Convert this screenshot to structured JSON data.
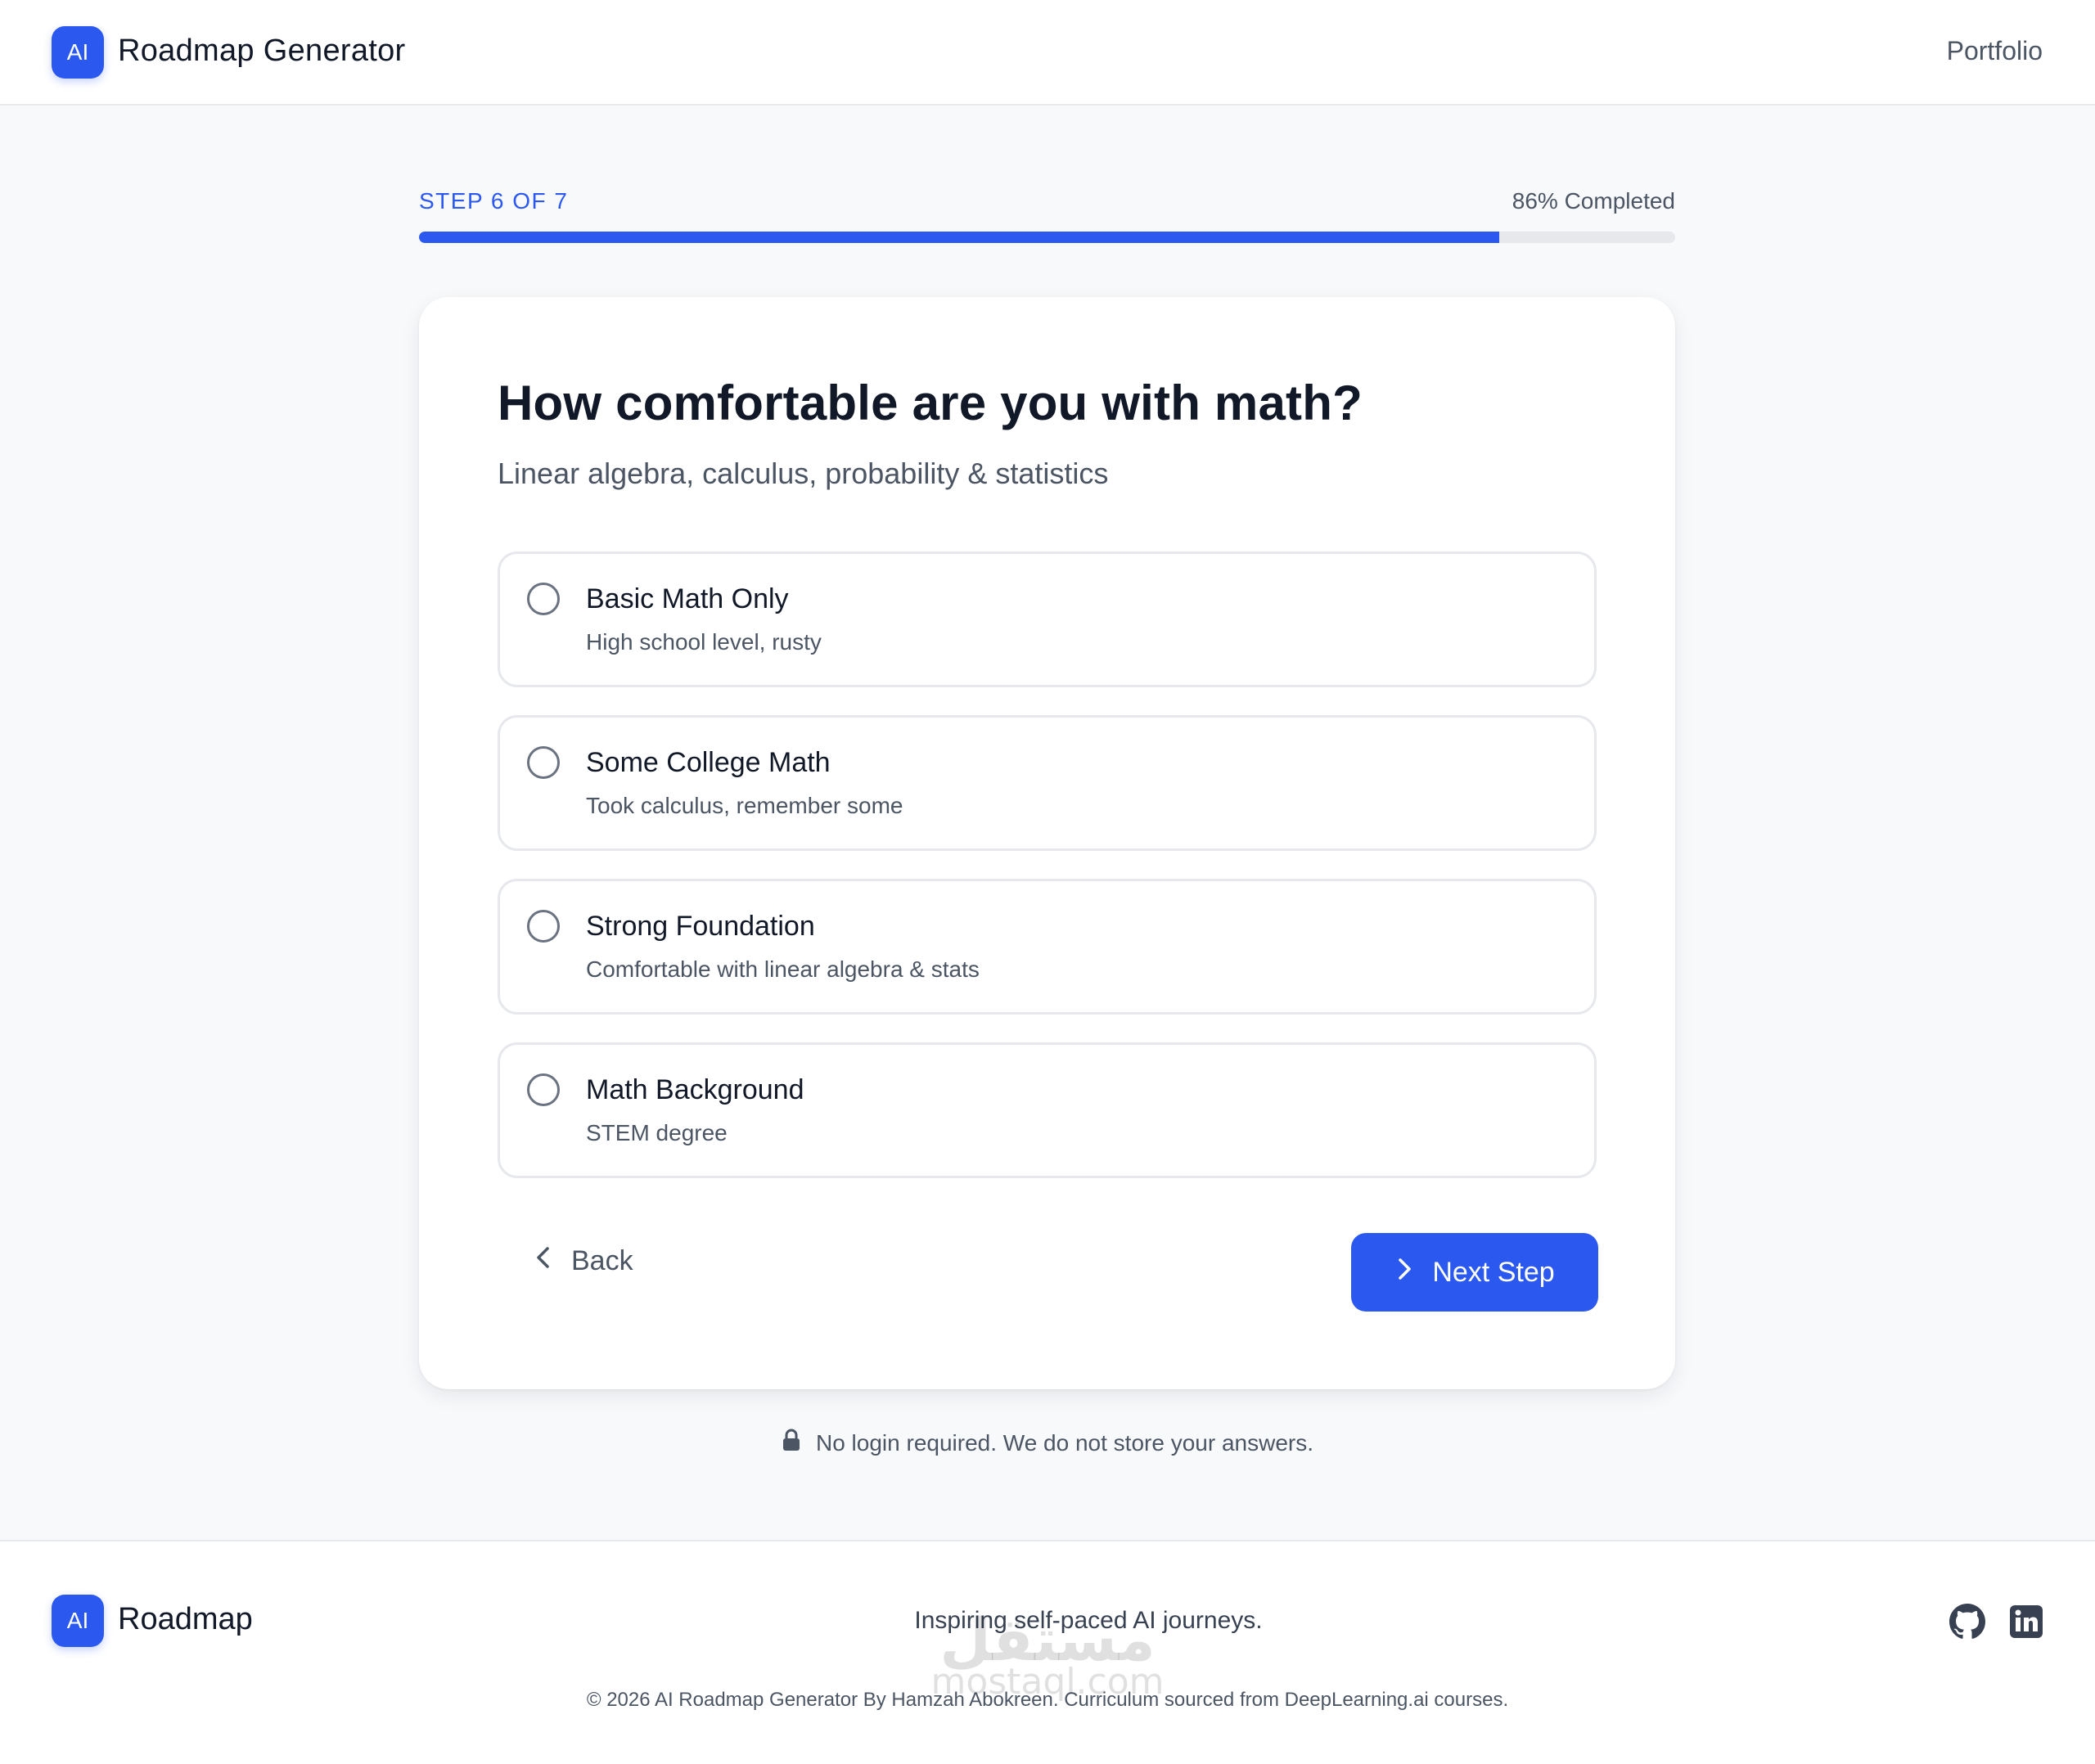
{
  "header": {
    "logo_text": "AI",
    "brand": "Roadmap Generator",
    "nav_portfolio": "Portfolio"
  },
  "progress": {
    "step_label": "STEP 6 OF 7",
    "completed_label": "86% Completed",
    "value": 0.86,
    "color": "#2b59f0"
  },
  "question": {
    "title": "How comfortable are you with math?",
    "subtitle": "Linear algebra, calculus, probability & statistics",
    "options": [
      {
        "title": "Basic Math Only",
        "desc": "High school level, rusty"
      },
      {
        "title": "Some College Math",
        "desc": "Took calculus, remember some"
      },
      {
        "title": "Strong Foundation",
        "desc": "Comfortable with linear algebra & stats"
      },
      {
        "title": "Math Background",
        "desc": "STEM degree"
      }
    ]
  },
  "actions": {
    "back_label": "Back",
    "next_label": "Next Step"
  },
  "privacy_note": "No login required. We do not store your answers.",
  "footer": {
    "logo_text": "AI",
    "brand": "Roadmap",
    "tagline": "Inspiring self-paced AI journeys.",
    "copyright": "© 2026 AI Roadmap Generator By Hamzah Abokreen. Curriculum sourced from DeepLearning.ai courses.",
    "icons": [
      "github-icon",
      "linkedin-icon"
    ]
  },
  "watermark": {
    "arabic": "مستقل",
    "latin": "mostaql.com"
  }
}
